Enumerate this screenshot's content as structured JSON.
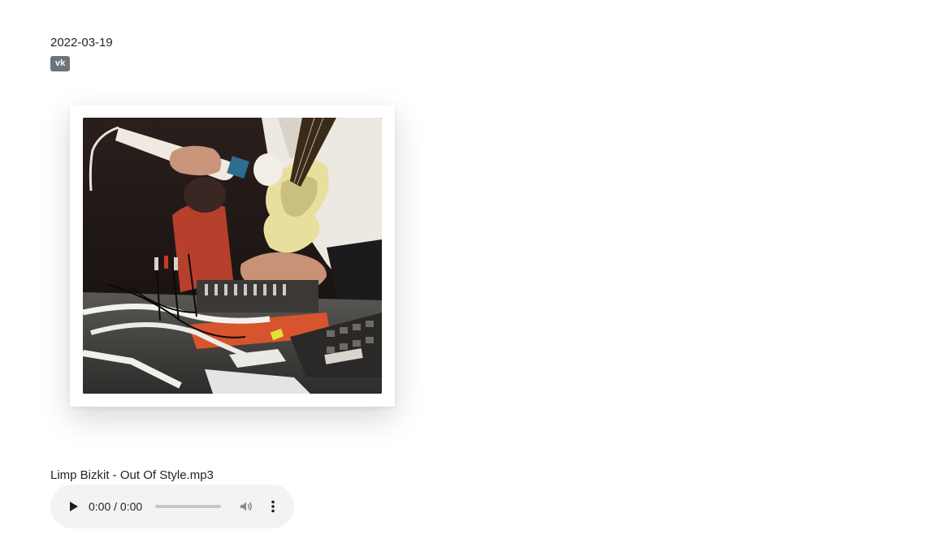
{
  "post": {
    "date": "2022-03-19",
    "tag": "vk"
  },
  "image": {
    "alt": "Cover photo"
  },
  "audio": {
    "file_name": "Limp Bizkit - Out Of Style.mp3",
    "time": "0:00 / 0:00",
    "progress": 0,
    "icons": {
      "play": "play-icon",
      "volume": "volume-icon",
      "more": "more-vertical-icon"
    }
  },
  "colors": {
    "badge_bg": "#6c757d",
    "player_bg": "#f1f3f4"
  }
}
